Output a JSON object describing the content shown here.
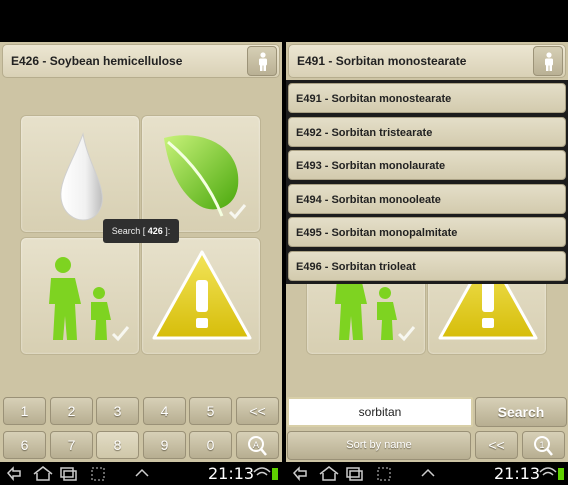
{
  "left": {
    "header": {
      "title": "E426 - Soybean hemicellulose"
    },
    "toast": {
      "prefix": "Search [ ",
      "code": "426",
      "suffix": " ]:"
    },
    "keypad": {
      "row1": [
        "1",
        "2",
        "3",
        "4",
        "5",
        "<<"
      ],
      "row2": [
        "6",
        "7",
        "8",
        "9",
        "0"
      ]
    },
    "tiles": [
      "drop-icon",
      "leaf-check-icon",
      "family-check-icon",
      "warning-icon"
    ],
    "navbar": {
      "time": "21:13"
    }
  },
  "right": {
    "header": {
      "title": "E491 - Sorbitan monostearate"
    },
    "dropdown": [
      "E491 - Sorbitan monostearate",
      "E492 - Sorbitan tristearate",
      "E493 - Sorbitan monolaurate",
      "E494 - Sorbitan monooleate",
      "E495 - Sorbitan monopalmitate",
      "E496 - Sorbitan trioleat"
    ],
    "search": {
      "value": "sorbitan",
      "button": "Search"
    },
    "sort": {
      "label": "Sort by name",
      "back": "<<"
    },
    "navbar": {
      "time": "21:13"
    }
  },
  "colors": {
    "background": "#cdc4a4",
    "green": "#7ed321",
    "warning": "#e3cc18"
  }
}
